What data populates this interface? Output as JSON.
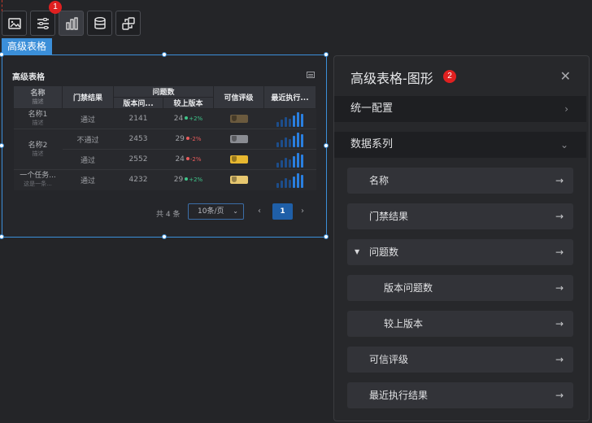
{
  "toolbar": {
    "buttons": [
      {
        "icon": "image-icon"
      },
      {
        "icon": "sliders-icon"
      },
      {
        "icon": "bar-chart-icon",
        "active": true
      },
      {
        "icon": "database-icon"
      },
      {
        "icon": "interaction-icon"
      }
    ],
    "badge": "1"
  },
  "component_tag": "高级表格",
  "widget": {
    "title": "高级表格",
    "headers": {
      "name": "名称",
      "name_sub": "描述",
      "gate": "门禁结果",
      "issues": "问题数",
      "version_issues": "版本问...",
      "vs_prev": "较上版本",
      "trust": "可信评级",
      "recent": "最近执行..."
    },
    "rows": [
      {
        "name": "名称1",
        "desc": "描述",
        "gate": "通过",
        "version_issues": "2141",
        "issues": "24",
        "delta": "+2%",
        "delta_dir": "up",
        "trust_color": "#6b5a3e"
      },
      {
        "name": "名称2",
        "desc": "描述",
        "gate": "不通过",
        "version_issues": "2453",
        "issues": "29",
        "delta": "-2%",
        "delta_dir": "down",
        "trust_color": "#8a8c92"
      },
      {
        "name": "",
        "desc": "",
        "gate": "通过",
        "version_issues": "2552",
        "issues": "24",
        "delta": "-2%",
        "delta_dir": "down",
        "trust_color": "#e8b830"
      },
      {
        "name": "一个任务...",
        "desc": "这是一条...",
        "gate": "通过",
        "version_issues": "4232",
        "issues": "29",
        "delta": "+2%",
        "delta_dir": "up",
        "trust_color": "#e8c870"
      }
    ],
    "pager": {
      "total": "共 4 条",
      "page_size": "10条/页",
      "caret": "⌄",
      "prev": "‹",
      "current": "1",
      "next": "›"
    }
  },
  "panel": {
    "title": "高级表格-图形",
    "badge": "2",
    "close": "✕",
    "sections": [
      {
        "label": "统一配置",
        "chev": "›"
      },
      {
        "label": "数据系列",
        "chev": "⌄"
      }
    ],
    "items": [
      {
        "label": "名称"
      },
      {
        "label": "门禁结果"
      },
      {
        "label": "问题数",
        "expandable": true
      },
      {
        "label": "版本问题数",
        "nested": true
      },
      {
        "label": "较上版本",
        "nested": true
      },
      {
        "label": "可信评级"
      },
      {
        "label": "最近执行结果"
      }
    ],
    "arrow": "→",
    "tri": "▼"
  },
  "colors": {
    "accent": "#3b8fd9",
    "badge": "#e02020",
    "up": "#3fc58a",
    "down": "#e85c5c",
    "bar_bright": "#2a7fe0",
    "bar_dim": "#1d4d8a"
  }
}
